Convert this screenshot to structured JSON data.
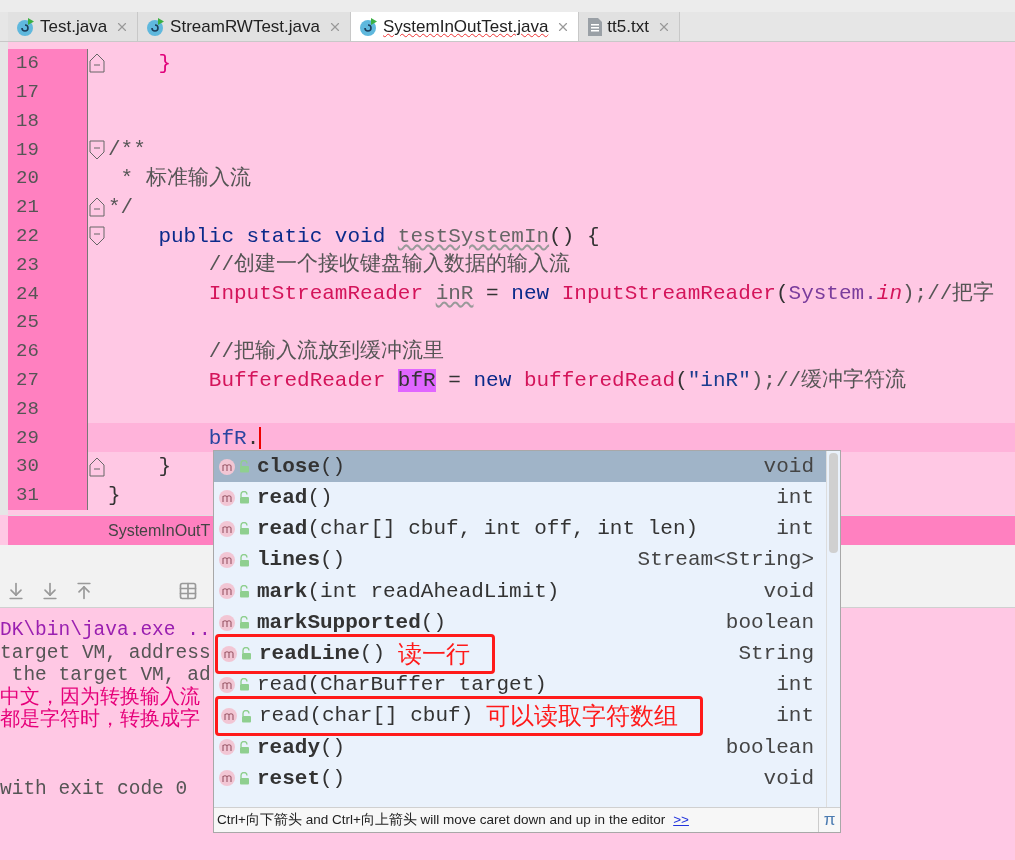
{
  "tabs": [
    {
      "label": "Test.java",
      "selected": false,
      "kind": "class"
    },
    {
      "label": "StreamRWTest.java",
      "selected": false,
      "kind": "class"
    },
    {
      "label": "SystemInOutTest.java",
      "selected": true,
      "kind": "class"
    },
    {
      "label": "tt5.txt",
      "selected": false,
      "kind": "text"
    }
  ],
  "editor": {
    "lines": [
      {
        "number": "16",
        "kind": "fold_end",
        "current": false,
        "tokens": [
          {
            "text": "    }",
            "kind": "brace"
          }
        ]
      },
      {
        "number": "17",
        "kind": "plain",
        "current": false
      },
      {
        "number": "18",
        "kind": "plain",
        "current": false
      },
      {
        "number": "19",
        "kind": "fold_start",
        "current": false,
        "tokens": [
          {
            "text": "/**",
            "kind": "comment"
          }
        ]
      },
      {
        "number": "20",
        "kind": "plain",
        "current": false,
        "tokens": [
          {
            "text": " * 标准输入流",
            "kind": "comment"
          }
        ]
      },
      {
        "number": "21",
        "kind": "fold_end",
        "current": false,
        "tokens": [
          {
            "text": "*/",
            "kind": "comment"
          }
        ]
      },
      {
        "number": "22",
        "kind": "fold_start",
        "current": false,
        "tokens": [
          {
            "text": "    public static void ",
            "kind": "keyword"
          },
          {
            "text": "testSystemIn",
            "kind": "unused"
          },
          {
            "text": "() {",
            "kind": "plain"
          }
        ]
      },
      {
        "number": "23",
        "kind": "plain",
        "current": false,
        "tokens": [
          {
            "text": "        //创建一个接收键盘输入数据的输入流",
            "kind": "comment"
          }
        ]
      },
      {
        "number": "24",
        "kind": "plain",
        "current": false,
        "tokens": [
          {
            "text": "        InputStreamReader ",
            "kind": "class"
          },
          {
            "text": "inR",
            "kind": "unused"
          },
          {
            "text": " = ",
            "kind": "plain"
          },
          {
            "text": "new ",
            "kind": "keyword"
          },
          {
            "text": "InputStreamReader",
            "kind": "class"
          },
          {
            "text": "(",
            "kind": "plain"
          },
          {
            "text": "System.",
            "kind": "field"
          },
          {
            "text": "in",
            "kind": "static"
          },
          {
            "text": ");//把字",
            "kind": "comment"
          }
        ]
      },
      {
        "number": "25",
        "kind": "plain",
        "current": false
      },
      {
        "number": "26",
        "kind": "plain",
        "current": false,
        "tokens": [
          {
            "text": "        //把输入流放到缓冲流里",
            "kind": "comment"
          }
        ]
      },
      {
        "number": "27",
        "kind": "plain",
        "current": false,
        "tokens": [
          {
            "text": "        BufferedReader ",
            "kind": "class"
          },
          {
            "text": "bfR",
            "kind": "match"
          },
          {
            "text": " = ",
            "kind": "plain"
          },
          {
            "text": "new ",
            "kind": "keyword"
          },
          {
            "text": "bufferedRead",
            "kind": "class"
          },
          {
            "text": "(",
            "kind": "plain"
          },
          {
            "text": "\"inR\"",
            "kind": "string"
          },
          {
            "text": ");//缓冲字符流",
            "kind": "comment"
          }
        ]
      },
      {
        "number": "28",
        "kind": "plain",
        "current": false
      },
      {
        "number": "29",
        "kind": "plain",
        "current": true,
        "tokens": [
          {
            "text": "        bfR",
            "kind": "variable"
          },
          {
            "text": ".",
            "kind": "plain"
          }
        ]
      },
      {
        "number": "30",
        "kind": "fold_end",
        "current": false,
        "tokens": [
          {
            "text": "    }",
            "kind": "plain"
          }
        ]
      },
      {
        "number": "31",
        "kind": "plain",
        "current": false,
        "tokens": [
          {
            "text": "}",
            "kind": "plain"
          }
        ]
      }
    ],
    "breadcrumb": "SystemInOutT"
  },
  "console": {
    "lines": [
      {
        "text": "DK\\bin\\java.exe ..",
        "kind": "command"
      },
      {
        "text": "target VM, address",
        "kind": "info"
      },
      {
        "text": " the target VM, ad",
        "kind": "info"
      },
      {
        "text": "中文，因为转换输入流",
        "kind": "error"
      },
      {
        "text": "都是字符时，转换成字",
        "kind": "error"
      },
      {
        "kind": "blank"
      },
      {
        "kind": "blank"
      },
      {
        "text": "with exit code 0",
        "kind": "info"
      }
    ]
  },
  "completion": {
    "items": [
      {
        "signature": "**close**()",
        "type": "void",
        "selected": true
      },
      {
        "signature": "**read**()",
        "type": "int",
        "selected": false
      },
      {
        "signature": "**read**(char[] cbuf, int off, int len)",
        "type": "int",
        "selected": false
      },
      {
        "signature": "**lines**()",
        "type": "Stream<String>",
        "selected": false
      },
      {
        "signature": "**mark**(int readAheadLimit)",
        "type": "void",
        "selected": false
      },
      {
        "signature": "**markSupported**()",
        "type": "boolean",
        "selected": false
      },
      {
        "signature": "**readLine**()",
        "type": "String",
        "selected": false,
        "note": "读一行"
      },
      {
        "signature": "read(CharBuffer target)",
        "type": "int",
        "selected": false
      },
      {
        "signature": "read(char[] cbuf)",
        "type": "int",
        "selected": false,
        "note": "可以读取字符数组"
      },
      {
        "signature": "**ready**()",
        "type": "boolean",
        "selected": false
      },
      {
        "signature": "**reset**()",
        "type": "void",
        "selected": false
      }
    ],
    "hint": "Ctrl+向下箭头 and Ctrl+向上箭头 will move caret down and up in the editor",
    "hint_link": ">>",
    "pi": "π"
  }
}
